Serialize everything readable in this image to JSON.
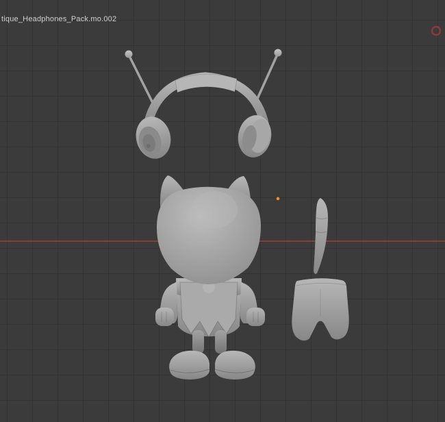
{
  "viewport": {
    "active_object_label": "tique_Headphones_Pack.mo.002",
    "colors": {
      "background": "#3b3b3b",
      "grid_line": "#333333",
      "x_axis_red": "#9c403d",
      "cursor_orange": "#ef9434",
      "origin_ring_red": "#8e3a36",
      "model_gray": "#9e9e9e"
    }
  },
  "scene_objects": [
    {
      "name": "headphones-with-antennas"
    },
    {
      "name": "cat-character-figure"
    },
    {
      "name": "tail-part"
    },
    {
      "name": "shorts-part"
    }
  ]
}
